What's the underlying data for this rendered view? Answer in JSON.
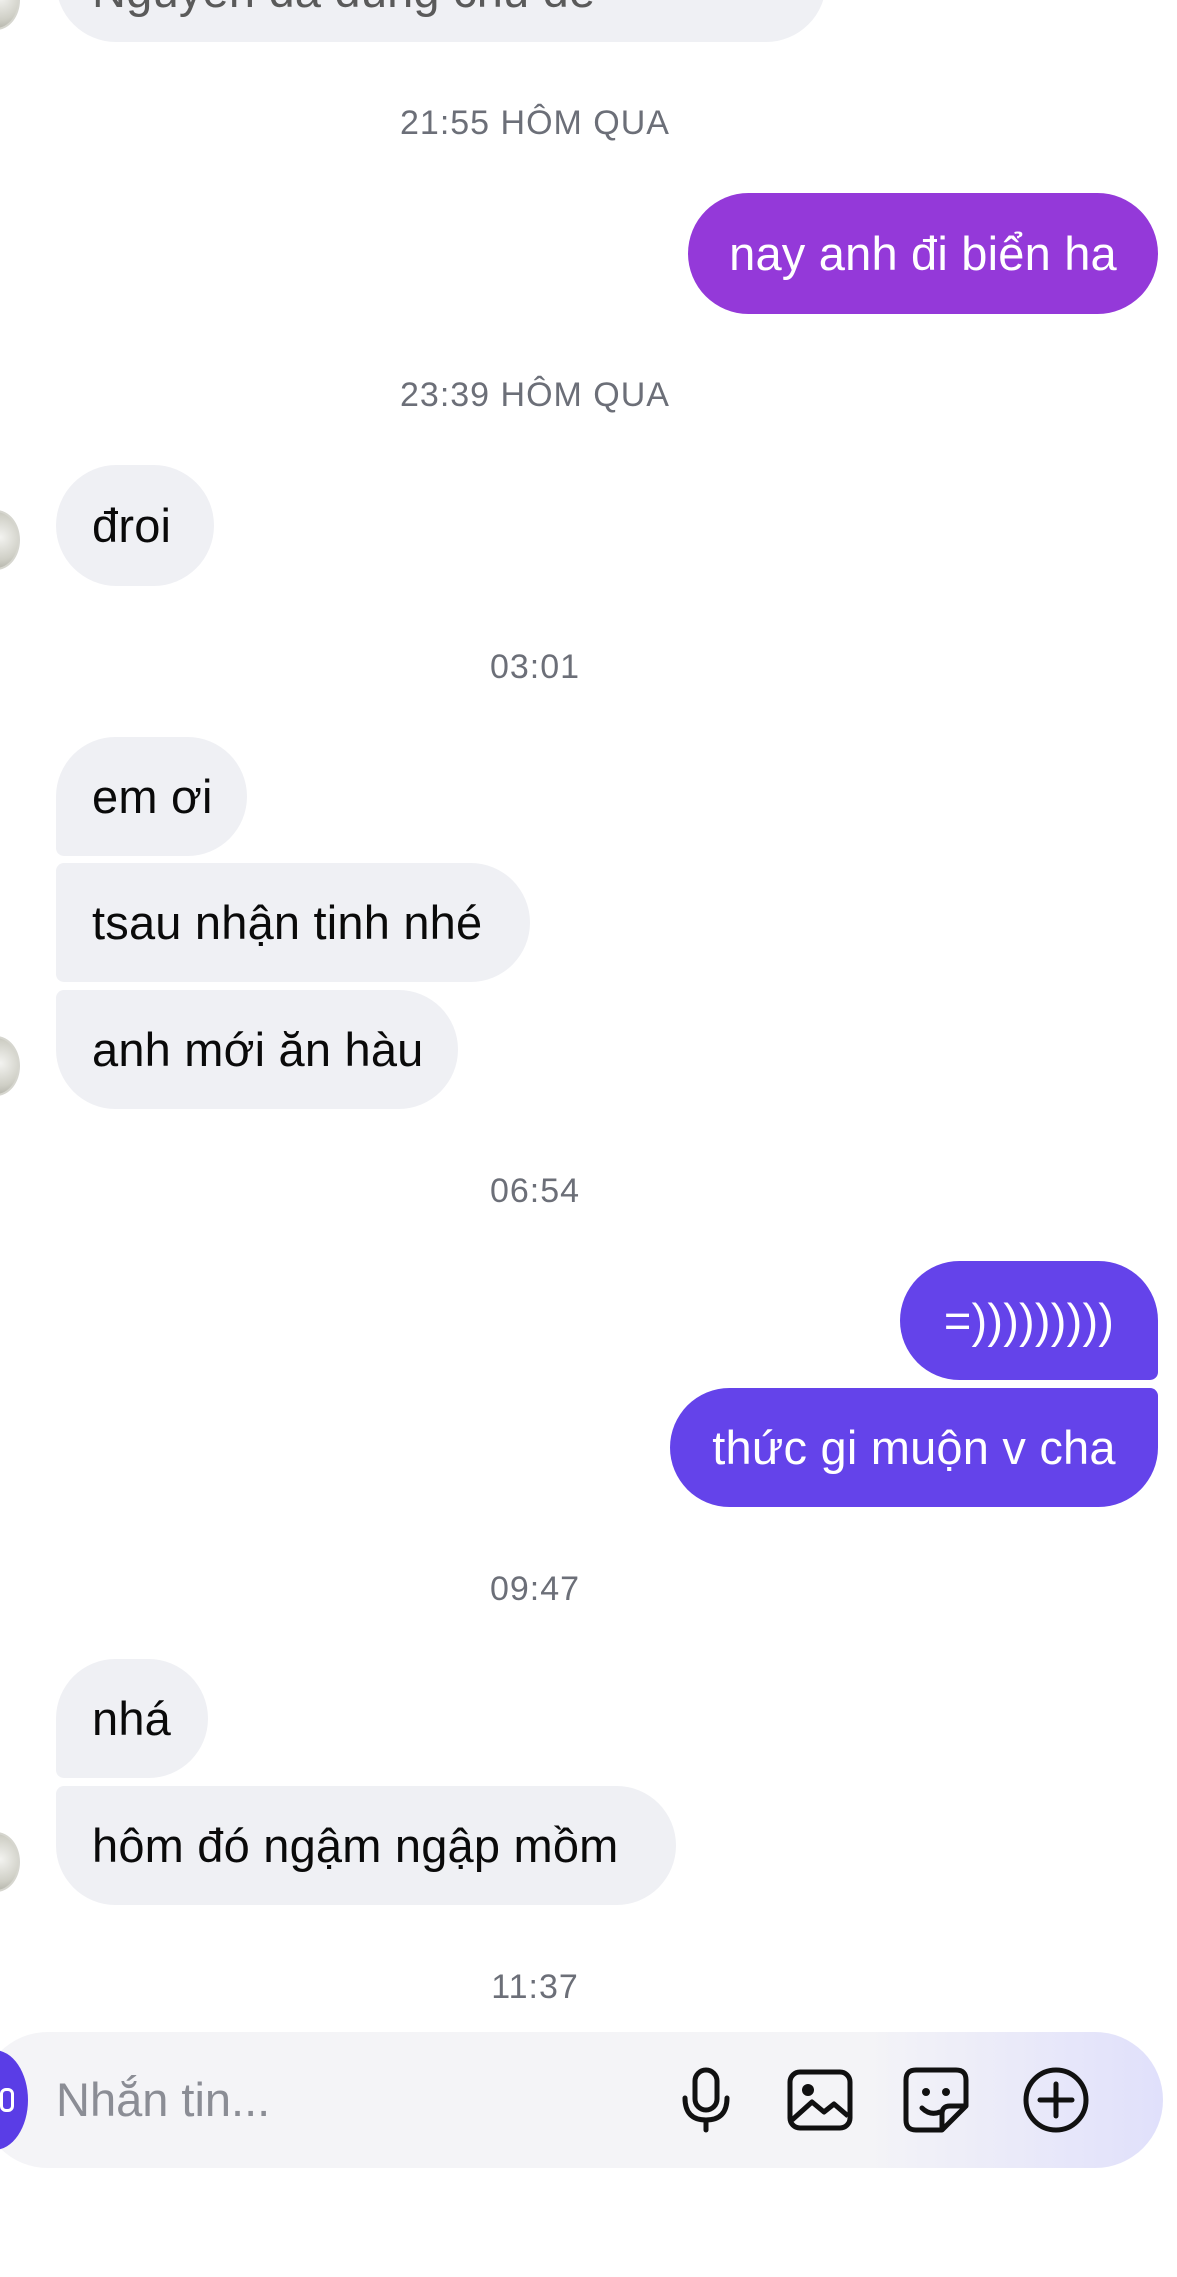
{
  "conversation": {
    "top_partial_text": "Nguyễn đã dùng chủ đề",
    "timestamps": {
      "t1": "21:55 HÔM QUA",
      "t2": "23:39 HÔM QUA",
      "t3": "03:01",
      "t4": "06:54",
      "t5": "09:47",
      "t6": "11:37"
    },
    "messages": {
      "m1": "nay anh đi biển ha",
      "m2": "đroi",
      "m3": "em ơi",
      "m4": "tsau nhận tinh nhé",
      "m5": "anh mới ăn hàu",
      "m6": "=)))))))))",
      "m7": "thức gi muộn v cha",
      "m8": "nhá",
      "m9": "hôm đó ngậm ngập mồm"
    }
  },
  "composer": {
    "placeholder": "Nhắn tin...",
    "icons": {
      "mic": "microphone-icon",
      "image": "image-icon",
      "sticker": "sticker-icon",
      "add": "plus-circle-icon"
    }
  },
  "colors": {
    "incoming_bubble": "#eff0f4",
    "outgoing_purple": "#9439d9",
    "outgoing_indigo": "#6443ea",
    "timestamp_text": "#6c6f78"
  }
}
